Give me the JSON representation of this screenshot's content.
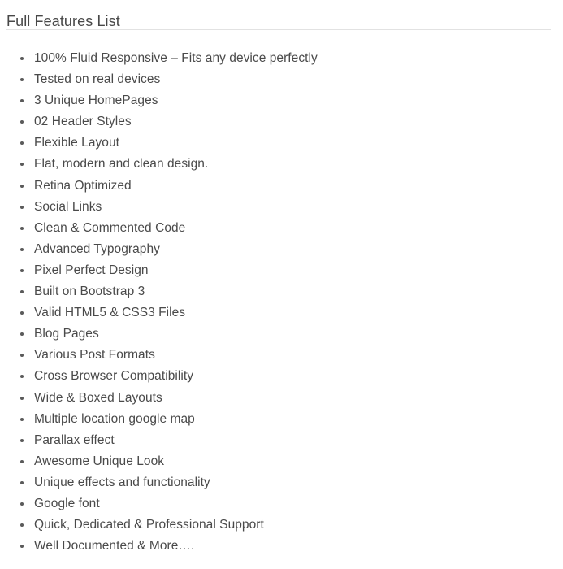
{
  "page": {
    "title": "Full Features List",
    "background_color": "#ffffff",
    "text_color": "#4a4a4a",
    "divider_color": "#e2e2e2",
    "bullet_color": "#5a5a5a"
  },
  "features": {
    "bullet_glyph": "•",
    "items": [
      {
        "label": "100% Fluid Responsive – Fits any device perfectly"
      },
      {
        "label": "Tested on real devices"
      },
      {
        "label": "3 Unique HomePages"
      },
      {
        "label": "02 Header Styles"
      },
      {
        "label": "Flexible Layout"
      },
      {
        "label": "Flat, modern and clean design."
      },
      {
        "label": "Retina Optimized"
      },
      {
        "label": "Social Links"
      },
      {
        "label": "Clean & Commented Code"
      },
      {
        "label": "Advanced Typography"
      },
      {
        "label": "Pixel Perfect Design"
      },
      {
        "label": "Built on Bootstrap 3"
      },
      {
        "label": "Valid HTML5 & CSS3 Files"
      },
      {
        "label": "Blog Pages"
      },
      {
        "label": "Various Post Formats"
      },
      {
        "label": "Cross Browser Compatibility"
      },
      {
        "label": "Wide & Boxed Layouts"
      },
      {
        "label": "Multiple location google map"
      },
      {
        "label": "Parallax effect"
      },
      {
        "label": "Awesome Unique Look"
      },
      {
        "label": "Unique effects and functionality"
      },
      {
        "label": "Google font"
      },
      {
        "label": "Quick, Dedicated & Professional Support"
      },
      {
        "label": "Well Documented & More…."
      }
    ]
  }
}
